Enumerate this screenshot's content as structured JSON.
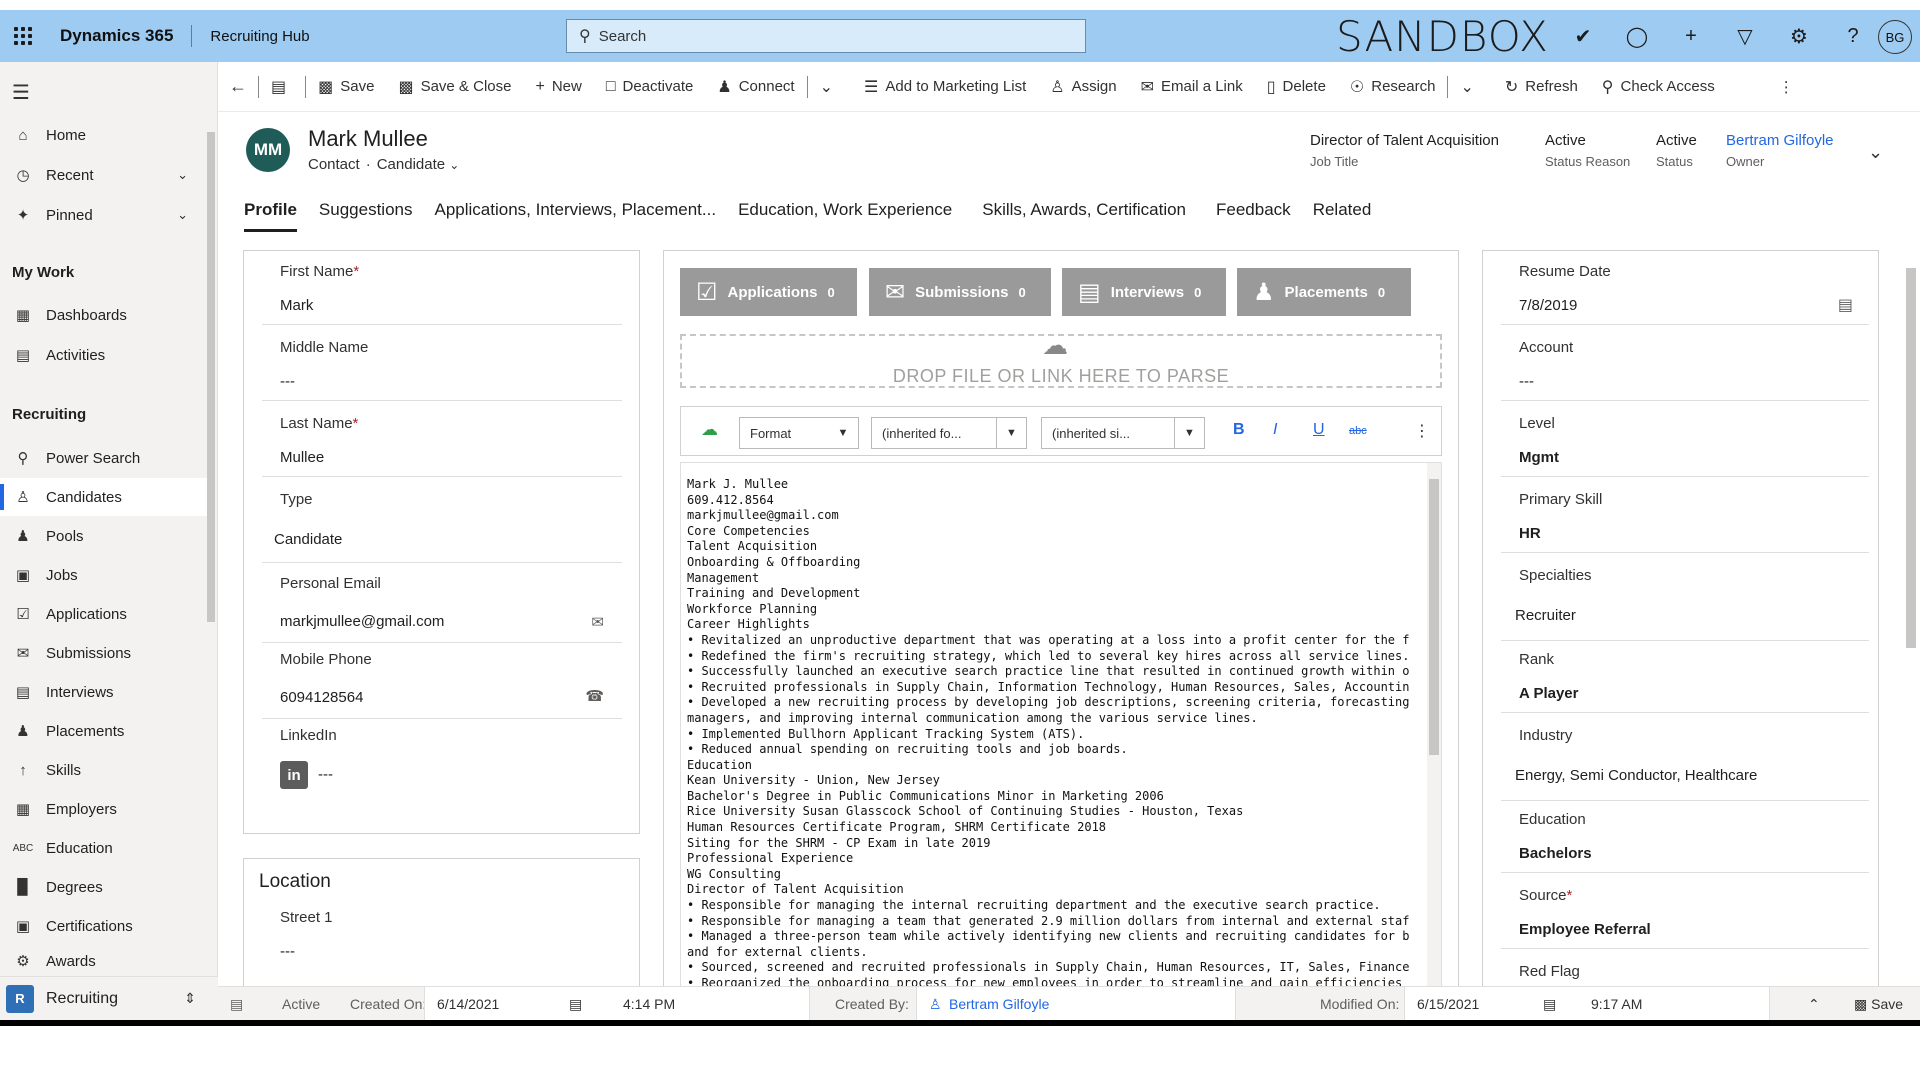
{
  "topbar": {
    "app_name": "Dynamics 365",
    "hub_name": "Recruiting Hub",
    "search_placeholder": "Search",
    "environment_label": "SANDBOX",
    "user_initials": "BG",
    "icons": [
      "task-check-icon",
      "lightbulb-icon",
      "plus-icon",
      "filter-icon",
      "settings-gear-icon",
      "help-icon"
    ]
  },
  "sidebar": {
    "home": "Home",
    "recent": "Recent",
    "pinned": "Pinned",
    "my_work_header": "My Work",
    "dashboards": "Dashboards",
    "activities": "Activities",
    "recruiting_header": "Recruiting",
    "items": [
      {
        "label": "Power Search",
        "icon": "search-icon"
      },
      {
        "label": "Candidates",
        "icon": "person-icon",
        "active": true
      },
      {
        "label": "Pools",
        "icon": "people-icon"
      },
      {
        "label": "Jobs",
        "icon": "briefcase-icon"
      },
      {
        "label": "Applications",
        "icon": "checkbox-icon"
      },
      {
        "label": "Submissions",
        "icon": "send-icon"
      },
      {
        "label": "Interviews",
        "icon": "calendar-icon"
      },
      {
        "label": "Placements",
        "icon": "group-icon"
      },
      {
        "label": "Skills",
        "icon": "skills-icon"
      },
      {
        "label": "Employers",
        "icon": "building-icon"
      },
      {
        "label": "Education",
        "icon": "abc-icon"
      },
      {
        "label": "Degrees",
        "icon": "book-icon"
      },
      {
        "label": "Certifications",
        "icon": "certificate-icon"
      },
      {
        "label": "Awards",
        "icon": "award-icon"
      }
    ],
    "area_badge": "R",
    "area_label": "Recruiting"
  },
  "commands": {
    "save": "Save",
    "save_close": "Save & Close",
    "new": "New",
    "deactivate": "Deactivate",
    "connect": "Connect",
    "add_marketing": "Add to Marketing List",
    "assign": "Assign",
    "email_link": "Email a Link",
    "delete": "Delete",
    "research": "Research",
    "refresh": "Refresh",
    "check_access": "Check Access"
  },
  "record": {
    "initials": "MM",
    "name": "Mark Mullee",
    "entity": "Contact",
    "form": "Candidate",
    "job_title": "Director of Talent Acquisition",
    "job_title_label": "Job Title",
    "status_reason": "Active",
    "status_reason_label": "Status Reason",
    "status": "Active",
    "status_label": "Status",
    "owner": "Bertram Gilfoyle",
    "owner_label": "Owner"
  },
  "tabs": [
    "Profile",
    "Suggestions",
    "Applications, Interviews, Placement...",
    "Education, Work Experience",
    "Skills, Awards, Certification",
    "Feedback",
    "Related"
  ],
  "profile": {
    "first_name_label": "First Name",
    "first_name": "Mark",
    "middle_name_label": "Middle Name",
    "middle_name": "---",
    "last_name_label": "Last Name",
    "last_name": "Mullee",
    "type_label": "Type",
    "type": "Candidate",
    "email_label": "Personal Email",
    "email": "markjmullee@gmail.com",
    "phone_label": "Mobile Phone",
    "phone": "6094128564",
    "linkedin_label": "LinkedIn",
    "linkedin_badge": "in",
    "linkedin": "---",
    "location_header": "Location",
    "street_label": "Street 1",
    "street": "---"
  },
  "center": {
    "stats": [
      {
        "label": "Applications",
        "count": "0",
        "icon": "check-doc-icon"
      },
      {
        "label": "Submissions",
        "count": "0",
        "icon": "envelope-icon"
      },
      {
        "label": "Interviews",
        "count": "0",
        "icon": "calendar-icon"
      },
      {
        "label": "Placements",
        "count": "0",
        "icon": "people-icon"
      }
    ],
    "dropzone_text": "DROP FILE OR LINK HERE TO PARSE",
    "format_label": "Format",
    "font_select": "(inherited fo...",
    "size_select": "(inherited si...",
    "bold": "B",
    "italic": "I",
    "underline": "U",
    "strike": "abc",
    "resume_lines": [
      "Mark J. Mullee",
      "609.412.8564",
      "markjmullee@gmail.com",
      "Core Competencies",
      "Talent Acquisition",
      "Onboarding & Offboarding",
      "Management",
      "Training and Development",
      "Workforce Planning",
      "Career Highlights",
      "• Revitalized an unproductive department that was operating at a loss into a profit center for the f",
      "• Redefined the firm's recruiting strategy, which led to several key hires across all service lines.",
      "• Successfully launched an executive search practice line that resulted in continued growth within o",
      "• Recruited professionals in Supply Chain, Information Technology, Human Resources, Sales, Accountin",
      "• Developed a new recruiting process by developing job descriptions, screening criteria, forecasting",
      "managers, and improving internal communication among the various service lines.",
      "• Implemented Bullhorn Applicant Tracking System (ATS).",
      "• Reduced annual spending on recruiting tools and job boards.",
      "Education",
      "Kean University - Union, New Jersey",
      "Bachelor's Degree in Public Communications Minor in Marketing 2006",
      "Rice University Susan Glasscock School of Continuing Studies - Houston, Texas",
      "Human Resources Certificate Program, SHRM Certificate 2018",
      "Siting for the SHRM - CP Exam in late 2019",
      "Professional Experience",
      "WG Consulting",
      "Director of Talent Acquisition",
      "• Responsible for managing the internal recruiting department and the executive search practice.",
      "• Responsible for managing a team that generated 2.9 million dollars from internal and external staf",
      "• Managed a three-person team while actively identifying new clients and recruiting candidates for b",
      "and for external clients.",
      "• Sourced, screened and recruited professionals in Supply Chain, Human Resources, IT, Sales, Finance",
      "• Reorganized the onboarding process for new employees in order to streamline and gain efficiencies"
    ]
  },
  "right": {
    "resume_date_label": "Resume Date",
    "resume_date": "7/8/2019",
    "account_label": "Account",
    "account": "---",
    "level_label": "Level",
    "level": "Mgmt",
    "primary_skill_label": "Primary Skill",
    "primary_skill": "HR",
    "specialties_label": "Specialties",
    "specialties": "Recruiter",
    "rank_label": "Rank",
    "rank": "A Player",
    "industry_label": "Industry",
    "industry": "Energy, Semi Conductor, Healthcare",
    "education_label": "Education",
    "education": "Bachelors",
    "source_label": "Source",
    "source": "Employee Referral",
    "red_flag_label": "Red Flag"
  },
  "footer": {
    "status": "Active",
    "created_on_label": "Created On:",
    "created_on_date": "6/14/2021",
    "created_on_time": "4:14 PM",
    "created_by_label": "Created By:",
    "created_by": "Bertram Gilfoyle",
    "modified_on_label": "Modified On:",
    "modified_on_date": "6/15/2021",
    "modified_on_time": "9:17 AM",
    "save": "Save"
  },
  "colors": {
    "topbar": "#9ecbf1",
    "accent": "#2266e3",
    "avatar": "#1f5b57",
    "stat_button": "#9a9a9a",
    "required": "#a4262c"
  }
}
